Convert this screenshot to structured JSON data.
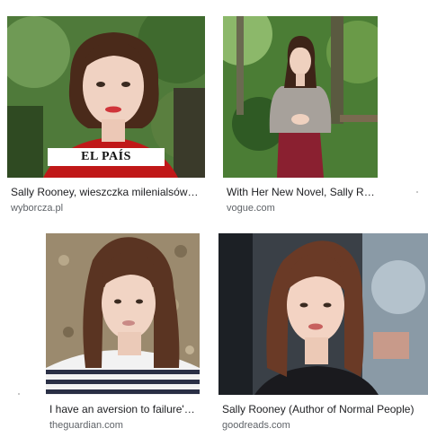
{
  "results": [
    {
      "title": "Sally Rooney, wieszczka milenialsów…",
      "source": "wyborcza.pl",
      "overlay_text": "EL PAÍS"
    },
    {
      "title": "With Her New Novel, Sally R…",
      "source": "vogue.com"
    },
    {
      "title": "I have an aversion to failure'…",
      "source": "theguardian.com"
    },
    {
      "title": "Sally Rooney (Author of Normal People)",
      "source": "goodreads.com"
    }
  ],
  "colors": {
    "title": "#202124",
    "source": "#5f6368",
    "background": "#ffffff"
  }
}
